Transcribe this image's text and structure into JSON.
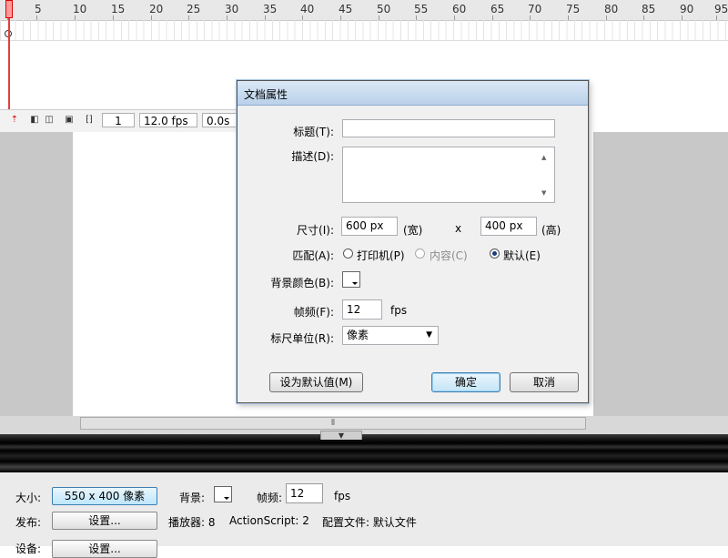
{
  "timeline": {
    "ruler_numbers": [
      "1",
      "5",
      "10",
      "15",
      "20",
      "25",
      "30",
      "35",
      "40",
      "45",
      "50",
      "55",
      "60",
      "65",
      "70",
      "75",
      "80",
      "85",
      "90",
      "95"
    ],
    "current_frame": "1",
    "frame_rate": "12.0 fps",
    "elapsed_time": "0.0s"
  },
  "dialog": {
    "title": "文档属性",
    "title_label": "标题(T):",
    "title_value": "",
    "description_label": "描述(D):",
    "description_value": "",
    "size_label": "尺寸(I):",
    "width_value": "600 px",
    "width_unit": "(宽)",
    "times_sign": "x",
    "height_value": "400 px",
    "height_unit": "(高)",
    "match_label": "匹配(A):",
    "match_options": [
      {
        "label": "打印机(P)",
        "selected": false,
        "disabled": false
      },
      {
        "label": "内容(C)",
        "selected": false,
        "disabled": true
      },
      {
        "label": "默认(E)",
        "selected": true,
        "disabled": false
      }
    ],
    "bg_color_label": "背景颜色(B):",
    "bg_color": "#ffffff",
    "frame_rate_label": "帧频(F):",
    "frame_rate_value": "12",
    "frame_rate_unit": "fps",
    "ruler_units_label": "标尺单位(R):",
    "ruler_units_value": "像素",
    "make_default_button": "设为默认值(M)",
    "ok_button": "确定",
    "cancel_button": "取消"
  },
  "properties": {
    "size_label": "大小:",
    "size_button": "550 x 400 像素",
    "background_label": "背景:",
    "frame_rate_label": "帧频:",
    "frame_rate_value": "12",
    "frame_rate_unit": "fps",
    "publish_label": "发布:",
    "settings_button": "设置...",
    "player_label": "播放器: 8",
    "actionscript_label": "ActionScript: 2",
    "profile_label": "配置文件: 默认文件",
    "device_label": "设备:",
    "device_button": "设置..."
  },
  "colors": {
    "playhead": "#e04040",
    "dialog_titlebar": "#b9d1ea",
    "default_button_border": "#3c7fb1"
  }
}
